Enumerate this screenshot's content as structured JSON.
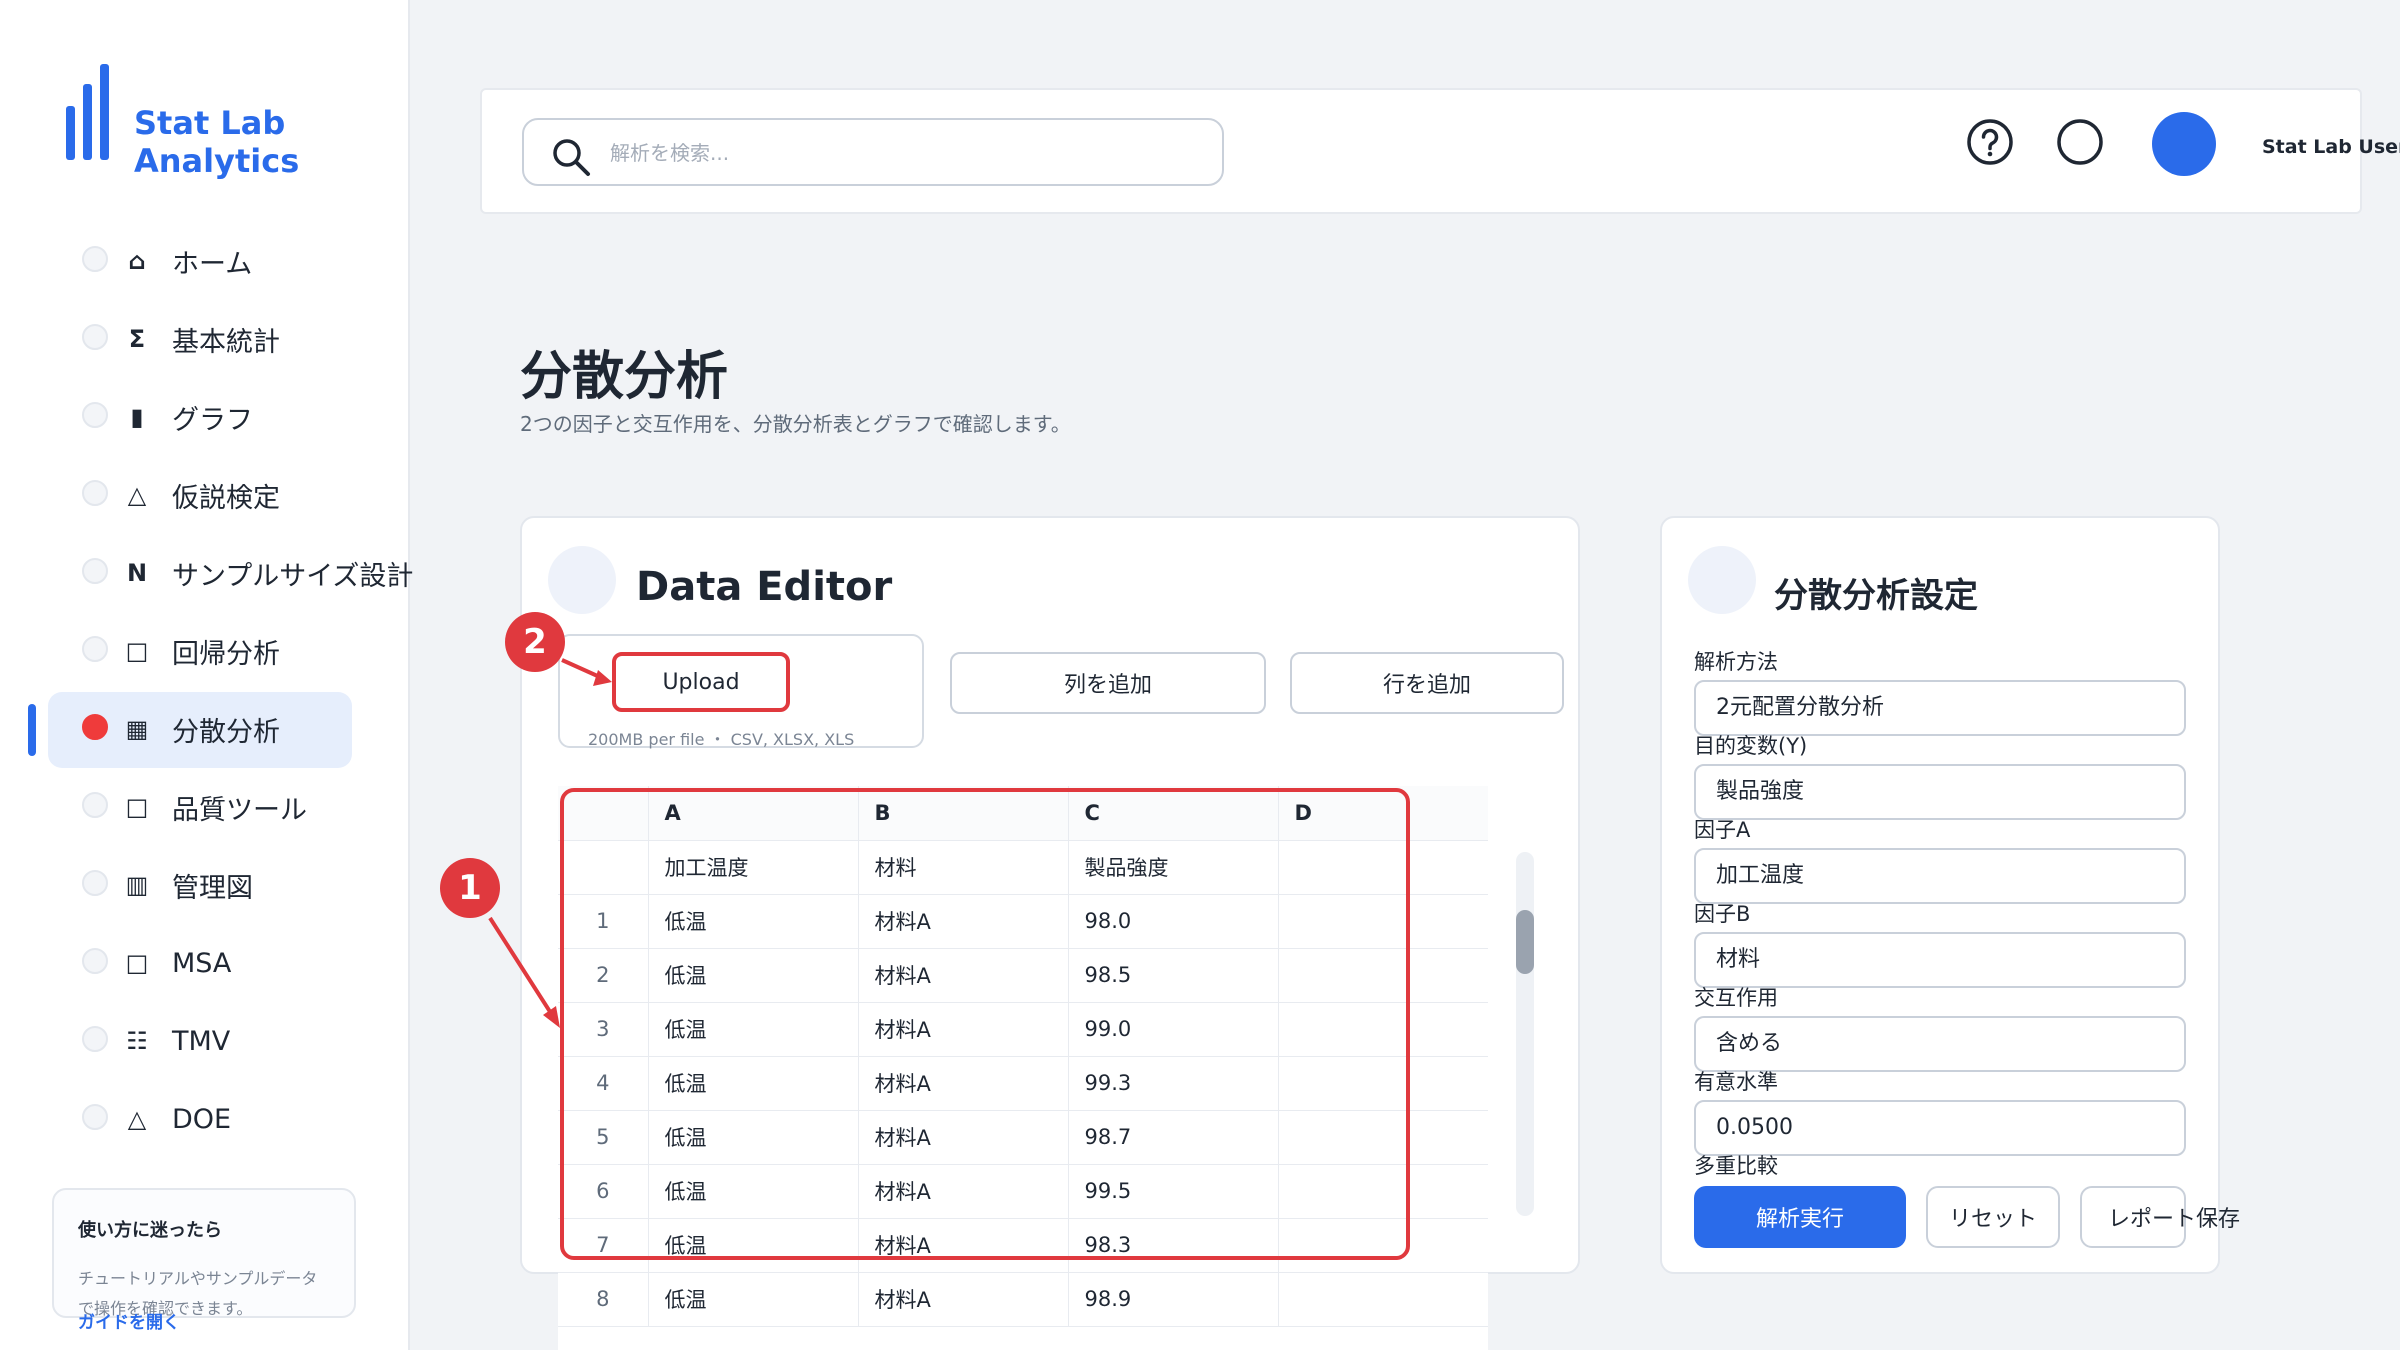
{
  "app": {
    "brand": "Stat Lab Analytics"
  },
  "sidebar": {
    "items": [
      {
        "icon": "home-icon",
        "glyph": "⌂",
        "label": "ホーム"
      },
      {
        "icon": "sigma-icon",
        "glyph": "Σ",
        "label": "基本統計"
      },
      {
        "icon": "bar-icon",
        "glyph": "▮",
        "label": "グラフ"
      },
      {
        "icon": "triangle-icon",
        "glyph": "△",
        "label": "仮説検定"
      },
      {
        "icon": "n-icon",
        "glyph": "N",
        "label": "サンプルサイズ設計"
      },
      {
        "icon": "square-icon",
        "glyph": "□",
        "label": "回帰分析"
      },
      {
        "icon": "grid-icon",
        "glyph": "▦",
        "label": "分散分析",
        "active": true
      },
      {
        "icon": "square-icon",
        "glyph": "□",
        "label": "品質ツール"
      },
      {
        "icon": "columns-icon",
        "glyph": "▥",
        "label": "管理図"
      },
      {
        "icon": "square-icon",
        "glyph": "□",
        "label": "MSA"
      },
      {
        "icon": "list-icon",
        "glyph": "☷",
        "label": "TMV"
      },
      {
        "icon": "triangle-icon",
        "glyph": "△",
        "label": "DOE"
      }
    ],
    "help": {
      "title": "使い方に迷ったら",
      "desc": "チュートリアルやサンプルデータで操作を確認できます。",
      "link": "ガイドを開く"
    }
  },
  "header": {
    "search_placeholder": "解析を検索...",
    "user_name": "Stat Lab User"
  },
  "page": {
    "title": "分散分析",
    "subtitle": "2つの因子と交互作用を、分散分析表とグラフで確認します。"
  },
  "editor": {
    "title": "Data Editor",
    "upload_label": "Upload",
    "upload_hint": "200MB per file ・ CSV, XLSX, XLS",
    "add_column": "列を追加",
    "add_row": "行を追加",
    "columns": [
      "",
      "A",
      "B",
      "C",
      "D"
    ],
    "header_row": [
      "",
      "加工温度",
      "材料",
      "製品強度",
      ""
    ],
    "rows": [
      [
        "1",
        "低温",
        "材料A",
        "98.0",
        ""
      ],
      [
        "2",
        "低温",
        "材料A",
        "98.5",
        ""
      ],
      [
        "3",
        "低温",
        "材料A",
        "99.0",
        ""
      ],
      [
        "4",
        "低温",
        "材料A",
        "99.3",
        ""
      ],
      [
        "5",
        "低温",
        "材料A",
        "98.7",
        ""
      ],
      [
        "6",
        "低温",
        "材料A",
        "99.5",
        ""
      ],
      [
        "7",
        "低温",
        "材料A",
        "98.3",
        ""
      ],
      [
        "8",
        "低温",
        "材料A",
        "98.9",
        ""
      ]
    ]
  },
  "annotations": {
    "badge1": "1",
    "badge2": "2"
  },
  "settings": {
    "title": "分散分析設定",
    "method_label": "解析方法",
    "method_value": "2元配置分散分析",
    "target_label": "目的変数(Y)",
    "target_value": "製品強度",
    "factor_a_label": "因子A",
    "factor_a_value": "加工温度",
    "factor_b_label": "因子B",
    "factor_b_value": "材料",
    "interaction_label": "交互作用",
    "interaction_value": "含める",
    "alpha_label": "有意水準",
    "alpha_value": "0.0500",
    "multi_label": "多重比較",
    "run": "解析実行",
    "reset": "リセット",
    "save": "レポート保存"
  },
  "colors": {
    "accent": "#2a6bea",
    "annotation": "#e0393e"
  }
}
